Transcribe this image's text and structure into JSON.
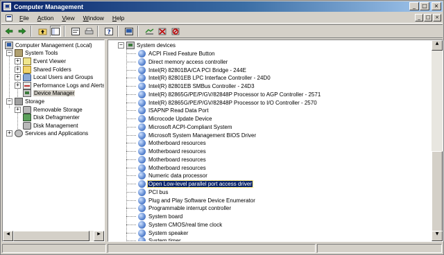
{
  "window": {
    "title": "Computer Management"
  },
  "title_buttons": {
    "minimize": "_",
    "maximize": "□",
    "close": "×"
  },
  "menu": {
    "items": [
      {
        "label": "File",
        "accel": "F",
        "rest": "ile"
      },
      {
        "label": "Action",
        "accel": "A",
        "rest": "ction"
      },
      {
        "label": "View",
        "accel": "V",
        "rest": "iew"
      },
      {
        "label": "Window",
        "accel": "W",
        "rest": "indow"
      },
      {
        "label": "Help",
        "accel": "H",
        "rest": "elp"
      }
    ]
  },
  "toolbar": {
    "icons": [
      "back-arrow-icon",
      "forward-arrow-icon",
      "up-folder-icon",
      "show-hide-tree-icon",
      "properties-icon",
      "print-icon",
      "help-icon",
      "scan-hardware-icon",
      "update-driver-icon",
      "uninstall-icon",
      "disable-icon"
    ]
  },
  "tree": {
    "root": "Computer Management (Local)",
    "system_tools": "System Tools",
    "event_viewer": "Event Viewer",
    "shared_folders": "Shared Folders",
    "local_users": "Local Users and Groups",
    "performance": "Performance Logs and Alerts",
    "device_manager": "Device Manager",
    "storage": "Storage",
    "removable_storage": "Removable Storage",
    "disk_defragmenter": "Disk Defragmenter",
    "disk_management": "Disk Management",
    "services": "Services and Applications"
  },
  "devices": {
    "category": "System devices",
    "selected_index": 17,
    "items": [
      "ACPI Fixed Feature Button",
      "Direct memory access controller",
      "Intel(R) 82801BA/CA PCI Bridge - 244E",
      "Intel(R) 82801EB LPC Interface Controller - 24D0",
      "Intel(R) 82801EB SMBus Controller - 24D3",
      "Intel(R) 82865G/PE/P/GV/82848P Processor to AGP Controller - 2571",
      "Intel(R) 82865G/PE/P/GV/82848P Processor to I/O Controller - 2570",
      "ISAPNP Read Data Port",
      "Microcode Update Device",
      "Microsoft ACPI-Compliant System",
      "Microsoft System Management BIOS Driver",
      "Motherboard resources",
      "Motherboard resources",
      "Motherboard resources",
      "Motherboard resources",
      "Numeric data processor",
      "Open Low-level parallel port access driver",
      "PCI bus",
      "Plug and Play Software Device Enumerator",
      "Programmable interrupt controller",
      "System board",
      "System CMOS/real time clock",
      "System speaker",
      "System timer"
    ]
  }
}
